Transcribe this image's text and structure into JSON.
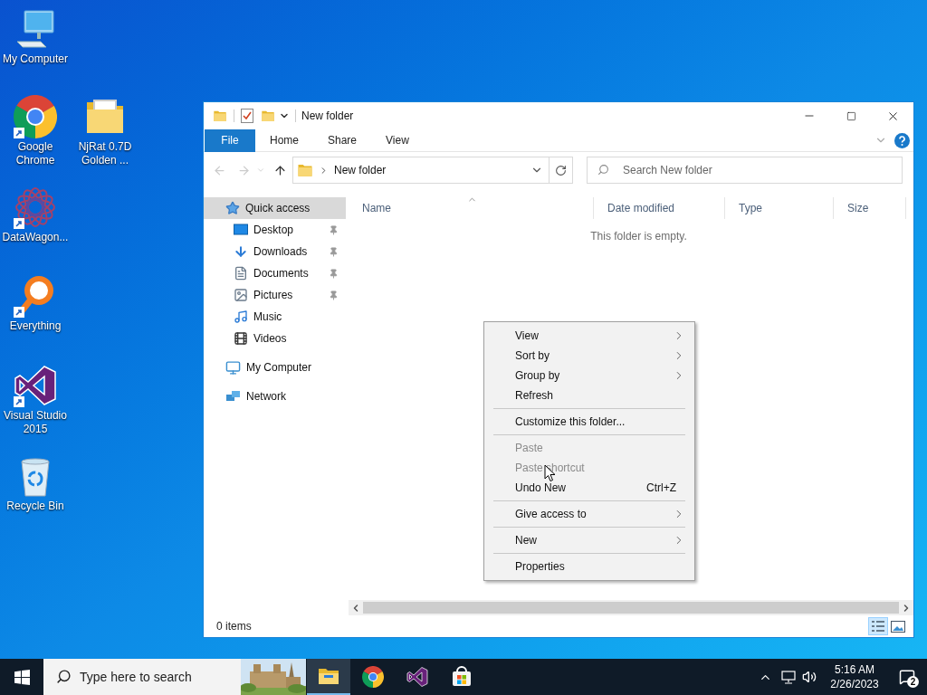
{
  "desktop_icons": [
    {
      "label": "My Computer",
      "kind": "computer",
      "shortcut": false
    },
    {
      "label": "Google Chrome",
      "kind": "chrome",
      "shortcut": true
    },
    {
      "label": "NjRat 0.7D Golden ...",
      "kind": "folder",
      "shortcut": false
    },
    {
      "label": "DataWagon...",
      "kind": "datawagon",
      "shortcut": true
    },
    {
      "label": "Everything",
      "kind": "everything",
      "shortcut": true
    },
    {
      "label": "Visual Studio 2015",
      "kind": "vs",
      "shortcut": true
    },
    {
      "label": "Recycle Bin",
      "kind": "recycle",
      "shortcut": false
    }
  ],
  "window": {
    "title": "New folder",
    "ribbon_tabs": [
      {
        "label": "File",
        "kind": "file"
      },
      {
        "label": "Home",
        "kind": "tab"
      },
      {
        "label": "Share",
        "kind": "tab"
      },
      {
        "label": "View",
        "kind": "tab"
      }
    ],
    "address": "New folder",
    "search": {
      "placeholder": "Search New folder"
    },
    "navigation": [
      {
        "label": "Quick access",
        "kind": "star",
        "selected": true,
        "children": [
          {
            "label": "Desktop",
            "kind": "desktop",
            "selected": false,
            "pinned": true
          },
          {
            "label": "Downloads",
            "kind": "downloads",
            "selected": false,
            "pinned": true
          },
          {
            "label": "Documents",
            "kind": "documents",
            "selected": false,
            "pinned": true
          },
          {
            "label": "Pictures",
            "kind": "pictures",
            "selected": false,
            "pinned": true
          },
          {
            "label": "Music",
            "kind": "music",
            "selected": false,
            "pinned": false
          },
          {
            "label": "Videos",
            "kind": "videos",
            "selected": false,
            "pinned": false
          }
        ]
      },
      {
        "label": "My Computer",
        "kind": "computer",
        "selected": false
      },
      {
        "label": "Network",
        "kind": "network",
        "selected": false
      }
    ],
    "columns": [
      {
        "label": "Name",
        "sorted": true
      },
      {
        "label": "Date modified",
        "sorted": false
      },
      {
        "label": "Type",
        "sorted": false
      },
      {
        "label": "Size",
        "sorted": false
      }
    ],
    "empty_message": "This folder is empty.",
    "status": "0 items",
    "view_buttons": [
      {
        "kind": "details",
        "selected": true
      },
      {
        "kind": "large-icons",
        "selected": false
      }
    ]
  },
  "context_menu": [
    {
      "kind": "item",
      "label": "View",
      "disabled": false,
      "submenu": true
    },
    {
      "kind": "item",
      "label": "Sort by",
      "disabled": false,
      "submenu": true
    },
    {
      "kind": "item",
      "label": "Group by",
      "disabled": false,
      "submenu": true
    },
    {
      "kind": "item",
      "label": "Refresh",
      "disabled": false,
      "submenu": false
    },
    {
      "kind": "separator"
    },
    {
      "kind": "item",
      "label": "Customize this folder...",
      "disabled": false,
      "submenu": false
    },
    {
      "kind": "separator"
    },
    {
      "kind": "item",
      "label": "Paste",
      "disabled": true,
      "submenu": false
    },
    {
      "kind": "item",
      "label": "Paste shortcut",
      "disabled": true,
      "submenu": false
    },
    {
      "kind": "item",
      "label": "Undo New",
      "disabled": false,
      "submenu": false,
      "shortcut": "Ctrl+Z"
    },
    {
      "kind": "separator"
    },
    {
      "kind": "item",
      "label": "Give access to",
      "disabled": false,
      "submenu": true
    },
    {
      "kind": "separator"
    },
    {
      "kind": "item",
      "label": "New",
      "disabled": false,
      "submenu": true
    },
    {
      "kind": "separator"
    },
    {
      "kind": "item",
      "label": "Properties",
      "disabled": false,
      "submenu": false
    }
  ],
  "taskbar": {
    "search_placeholder": "Type here to search",
    "apps": [
      {
        "kind": "explorer",
        "selected": true
      },
      {
        "kind": "chrome",
        "selected": false
      },
      {
        "kind": "vs",
        "selected": false
      },
      {
        "kind": "store",
        "selected": false
      }
    ],
    "time": "5:16 AM",
    "date": "2/26/2023",
    "notifications": "2"
  }
}
